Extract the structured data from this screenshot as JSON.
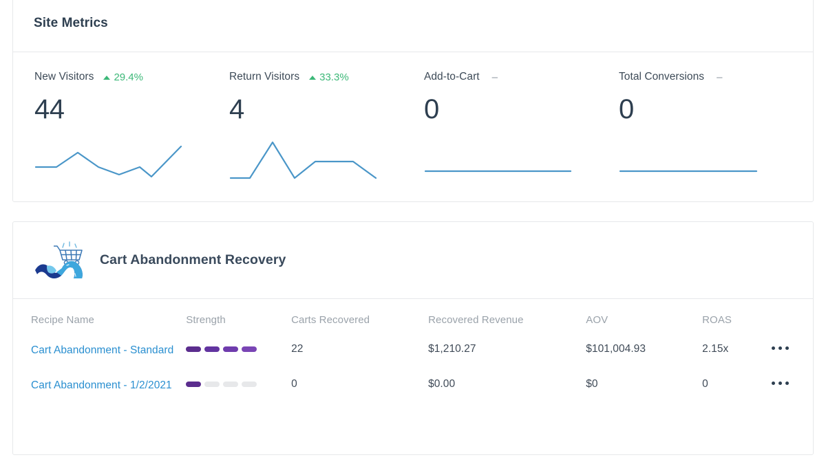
{
  "site_metrics": {
    "title": "Site Metrics",
    "metrics": [
      {
        "label": "New Visitors",
        "delta": "29.4%",
        "direction": "up",
        "value": "44"
      },
      {
        "label": "Return Visitors",
        "delta": "33.3%",
        "direction": "up",
        "value": "4"
      },
      {
        "label": "Add-to-Cart",
        "delta": "–",
        "direction": "none",
        "value": "0"
      },
      {
        "label": "Total Conversions",
        "delta": "–",
        "direction": "none",
        "value": "0"
      }
    ],
    "sparkline_color": "#4a96c8"
  },
  "chart_data": [
    {
      "type": "line",
      "title": "New Visitors",
      "x": [
        0,
        1,
        2,
        3,
        4,
        5,
        6,
        7
      ],
      "values": [
        30,
        30,
        52,
        36,
        20,
        28,
        12,
        62
      ],
      "ylim": [
        0,
        70
      ],
      "grid": false,
      "legend": "none",
      "xlabel": "",
      "ylabel": ""
    },
    {
      "type": "line",
      "title": "Return Visitors",
      "x": [
        0,
        1,
        2,
        3,
        4,
        5,
        6,
        7
      ],
      "values": [
        4,
        4,
        66,
        4,
        36,
        36,
        36,
        4
      ],
      "ylim": [
        0,
        70
      ],
      "grid": false,
      "legend": "none",
      "xlabel": "",
      "ylabel": ""
    },
    {
      "type": "line",
      "title": "Add-to-Cart",
      "x": [
        0,
        1,
        2,
        3,
        4,
        5,
        6,
        7
      ],
      "values": [
        0,
        0,
        0,
        0,
        0,
        0,
        0,
        0
      ],
      "ylim": [
        0,
        70
      ],
      "grid": false,
      "legend": "none",
      "xlabel": "",
      "ylabel": ""
    },
    {
      "type": "line",
      "title": "Total Conversions",
      "x": [
        0,
        1,
        2,
        3,
        4,
        5,
        6,
        7
      ],
      "values": [
        0,
        0,
        0,
        0,
        0,
        0,
        0,
        0
      ],
      "ylim": [
        0,
        70
      ],
      "grid": false,
      "legend": "none",
      "xlabel": "",
      "ylabel": ""
    }
  ],
  "cart_recovery": {
    "title": "Cart Abandonment Recovery",
    "logo_icon": "shopping-cart-road-logo",
    "table": {
      "headers": {
        "name": "Recipe Name",
        "strength": "Strength",
        "carts": "Carts Recovered",
        "revenue": "Recovered Revenue",
        "aov": "AOV",
        "roas": "ROAS"
      },
      "rows": [
        {
          "name": "Cart Abandonment - Standard",
          "strength_filled": 4,
          "strength_total": 4,
          "carts": "22",
          "revenue": "$1,210.27",
          "aov": "$101,004.93",
          "roas": "2.15x",
          "menu_icon": "overflow-menu-icon"
        },
        {
          "name": "Cart Abandonment - 1/2/2021",
          "strength_filled": 1,
          "strength_total": 4,
          "carts": "0",
          "revenue": "$0.00",
          "aov": "$0",
          "roas": "0",
          "menu_icon": "overflow-menu-icon"
        }
      ]
    }
  },
  "colors": {
    "link": "#2a8fd0",
    "positive": "#3cb878",
    "strength_fill": "#5b2d8e",
    "strength_empty": "#e7e8ea",
    "text_primary": "#2e3f50",
    "text_muted": "#9aa2aa"
  }
}
